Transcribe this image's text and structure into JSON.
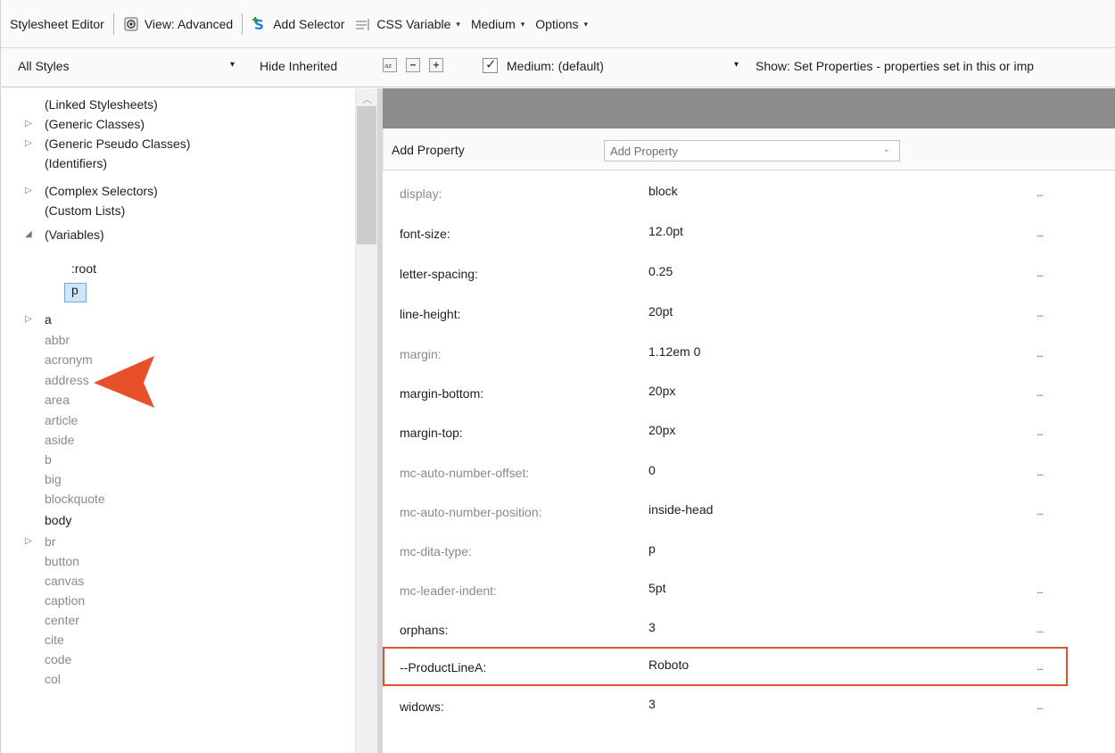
{
  "toolbar": {
    "title": "Stylesheet Editor",
    "view": "View: Advanced",
    "add_selector": "Add Selector",
    "css_variable": "CSS Variable",
    "medium": "Medium",
    "options": "Options",
    "caret": "▾"
  },
  "filterbar": {
    "styles_filter": "All Styles",
    "hide_inherited": "Hide Inherited",
    "medium_select": "Medium: (default)",
    "show_select": "Show: Set Properties - properties set in this or imp",
    "caret": "▾",
    "checkmark": "✓"
  },
  "tree": {
    "rows": [
      {
        "label": "(Linked Stylesheets)",
        "expander": "",
        "grey": false
      },
      {
        "label": "(Generic Classes)",
        "expander": "▷",
        "grey": false
      },
      {
        "label": "(Generic Pseudo Classes)",
        "expander": "▷",
        "grey": false
      },
      {
        "label": "(Identifiers)",
        "expander": "",
        "grey": false
      },
      {
        "label": "(Complex Selectors)",
        "expander": "▷",
        "grey": false
      },
      {
        "label": "(Custom Lists)",
        "expander": "",
        "grey": false
      },
      {
        "label": "(Variables)",
        "expander": "◢",
        "grey": false
      },
      {
        "label": ":root",
        "expander": "",
        "grey": false
      },
      {
        "label": "p",
        "expander": "",
        "grey": false
      },
      {
        "label": "a",
        "expander": "▷",
        "grey": false
      },
      {
        "label": "abbr",
        "expander": "",
        "grey": true
      },
      {
        "label": "acronym",
        "expander": "",
        "grey": true
      },
      {
        "label": "address",
        "expander": "",
        "grey": true
      },
      {
        "label": "area",
        "expander": "",
        "grey": true
      },
      {
        "label": "article",
        "expander": "",
        "grey": true
      },
      {
        "label": "aside",
        "expander": "",
        "grey": true
      },
      {
        "label": "b",
        "expander": "",
        "grey": true
      },
      {
        "label": "big",
        "expander": "",
        "grey": true
      },
      {
        "label": "blockquote",
        "expander": "",
        "grey": true
      },
      {
        "label": "body",
        "expander": "",
        "grey": false
      },
      {
        "label": "br",
        "expander": "▷",
        "grey": true
      },
      {
        "label": "button",
        "expander": "",
        "grey": true
      },
      {
        "label": "canvas",
        "expander": "",
        "grey": true
      },
      {
        "label": "caption",
        "expander": "",
        "grey": true
      },
      {
        "label": "center",
        "expander": "",
        "grey": true
      },
      {
        "label": "cite",
        "expander": "",
        "grey": true
      },
      {
        "label": "code",
        "expander": "",
        "grey": true
      },
      {
        "label": "col",
        "expander": "",
        "grey": true
      }
    ],
    "selected": "p"
  },
  "properties": {
    "add_label": "Add Property",
    "add_placeholder": "Add Property",
    "combo_caret": "⌄",
    "dots": "...",
    "rows": [
      {
        "name": "display:",
        "value": "block",
        "inherited": true,
        "dots": true
      },
      {
        "name": "font-size:",
        "value": "12.0pt",
        "inherited": false,
        "dots": true
      },
      {
        "name": "letter-spacing:",
        "value": "0.25",
        "inherited": false,
        "dots": true
      },
      {
        "name": "line-height:",
        "value": "20pt",
        "inherited": false,
        "dots": true
      },
      {
        "name": "margin:",
        "value": "1.12em 0",
        "inherited": true,
        "dots": true
      },
      {
        "name": "margin-bottom:",
        "value": "20px",
        "inherited": false,
        "dots": true
      },
      {
        "name": "margin-top:",
        "value": "20px",
        "inherited": false,
        "dots": true
      },
      {
        "name": "mc-auto-number-offset:",
        "value": "0",
        "inherited": true,
        "dots": true
      },
      {
        "name": "mc-auto-number-position:",
        "value": "inside-head",
        "inherited": true,
        "dots": true
      },
      {
        "name": "mc-dita-type:",
        "value": "p",
        "inherited": true,
        "dots": false
      },
      {
        "name": "mc-leader-indent:",
        "value": "5pt",
        "inherited": true,
        "dots": true
      },
      {
        "name": "orphans:",
        "value": "3",
        "inherited": false,
        "dots": true
      },
      {
        "name": "--ProductLineA:",
        "value": "Roboto",
        "inherited": false,
        "dots": true
      },
      {
        "name": "widows:",
        "value": "3",
        "inherited": false,
        "dots": true
      }
    ]
  },
  "colors": {
    "accent_highlight": "#e0522b",
    "header_grey": "#8c8c8c",
    "inherited_text": "#8a8a8a",
    "selection": "#cfe5f8"
  }
}
